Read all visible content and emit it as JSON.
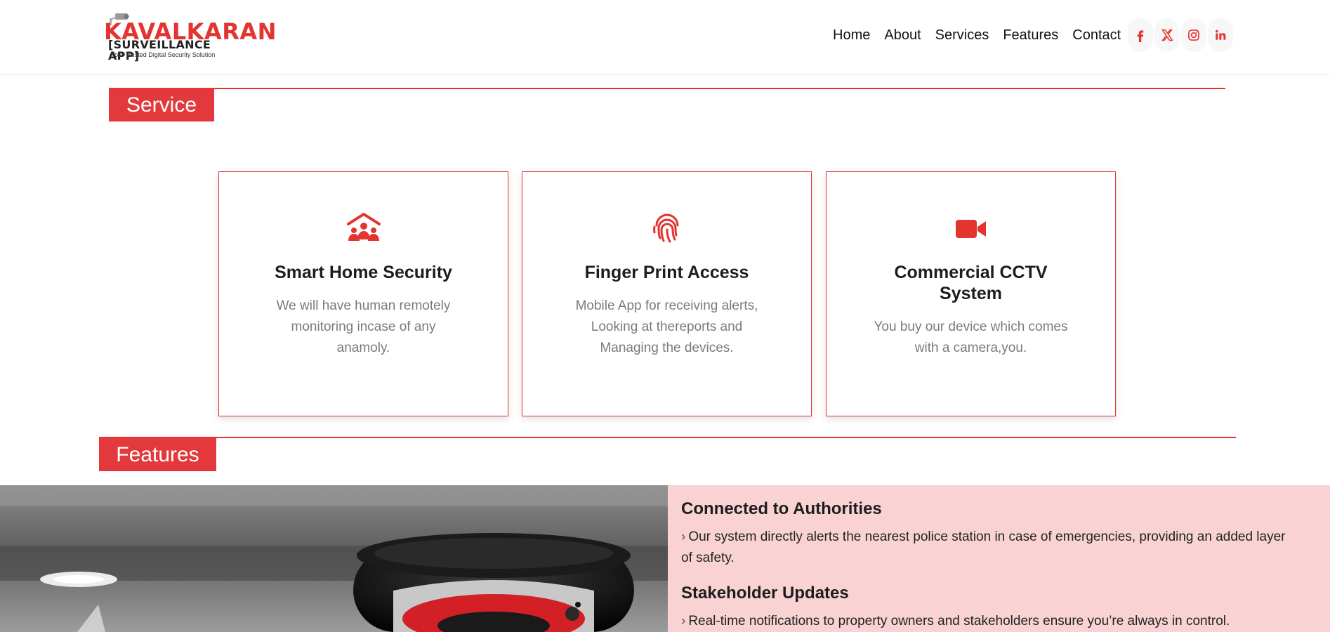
{
  "brand": {
    "name": "KAVALKARAN",
    "subtitle": "[SURVEILLANCE APP]",
    "tagline": "Your Trusted Digital Security Solution"
  },
  "nav": {
    "links": [
      "Home",
      "About",
      "Services",
      "Features",
      "Contact"
    ],
    "social": [
      "facebook-icon",
      "x-twitter-icon",
      "instagram-icon",
      "linkedin-icon"
    ]
  },
  "colors": {
    "accent": "#e3342f",
    "feature_panel": "#f9d3d4"
  },
  "service": {
    "heading": "Service",
    "cards": [
      {
        "icon": "home-people-icon",
        "title": "Smart Home Security",
        "desc": "We will have human remotely monitoring incase of any anamoly."
      },
      {
        "icon": "fingerprint-icon",
        "title": "Finger Print Access",
        "desc": "Mobile App for receiving alerts, Looking at thereports and Managing the devices."
      },
      {
        "icon": "video-camera-icon",
        "title": "Commercial CCTV System",
        "desc": "You buy our device which comes with a camera,you."
      }
    ]
  },
  "features": {
    "heading": "Features",
    "items": [
      {
        "title": "Connected to Authorities",
        "desc": "Our system directly alerts the nearest police station in case of emergencies, providing an added layer of safety."
      },
      {
        "title": "Stakeholder Updates",
        "desc": "Real-time notifications to property owners and stakeholders ensure you’re always in control."
      }
    ]
  }
}
